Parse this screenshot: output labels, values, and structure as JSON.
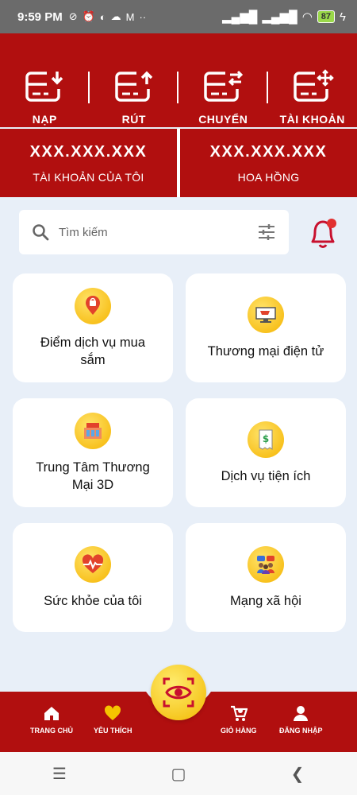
{
  "status_bar": {
    "time": "9:59 PM",
    "battery": "87"
  },
  "top_actions": [
    {
      "label": "NẠP",
      "icon": "deposit-icon"
    },
    {
      "label": "RÚT",
      "icon": "withdraw-icon"
    },
    {
      "label": "CHUYỂN",
      "icon": "transfer-icon"
    },
    {
      "label": "TÀI KHOẢN",
      "icon": "account-icon"
    }
  ],
  "balances": [
    {
      "amount": "XXX.XXX.XXX",
      "label": "TÀI KHOẢN CỦA TÔI"
    },
    {
      "amount": "XXX.XXX.XXX",
      "label": "HOA HỒNG"
    }
  ],
  "search": {
    "placeholder": "Tìm kiếm"
  },
  "tiles": [
    {
      "label": "Điểm dịch vụ mua sắm",
      "icon": "shopping-location-icon"
    },
    {
      "label": "Thương mại điện tử",
      "icon": "ecommerce-icon"
    },
    {
      "label": "Trung Tâm Thương Mại 3D",
      "icon": "mall-icon"
    },
    {
      "label": "Dịch vụ tiện ích",
      "icon": "utility-bill-icon"
    },
    {
      "label": "Sức khỏe của tôi",
      "icon": "health-heart-icon"
    },
    {
      "label": "Mạng xã hội",
      "icon": "social-network-icon"
    }
  ],
  "bottom_nav": [
    {
      "label": "TRANG CHỦ",
      "icon": "home-icon"
    },
    {
      "label": "YÊU THÍCH",
      "icon": "heart-icon"
    },
    {
      "label": "GIỎ HÀNG",
      "icon": "cart-icon"
    },
    {
      "label": "ĐĂNG NHẬP",
      "icon": "user-icon"
    }
  ],
  "colors": {
    "brand_red": "#b10f0f",
    "accent_yellow": "#f5b400",
    "background": "#e8eff8"
  }
}
